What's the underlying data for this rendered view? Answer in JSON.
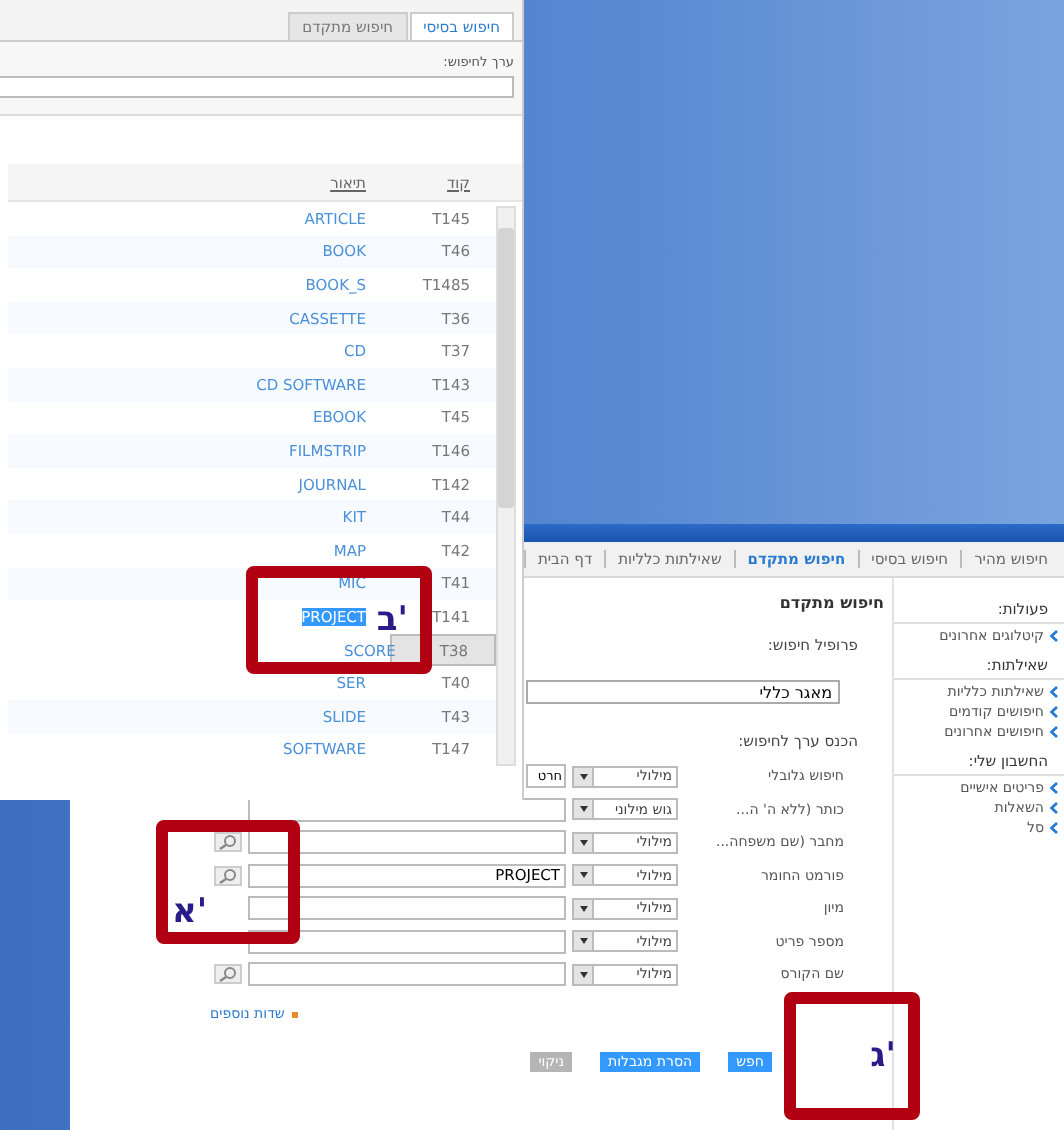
{
  "left_window": {
    "tabs": [
      {
        "label": "חיפוש בסיסי",
        "selected": true
      },
      {
        "label": "חיפוש מתקדם",
        "selected": false
      }
    ],
    "search_label": "ערך לחיפוש:",
    "table": {
      "columns": [
        "קוד",
        "תיאור"
      ],
      "rows": [
        {
          "code": "T145",
          "description": "ARTICLE",
          "selected": false,
          "text_selected": false
        },
        {
          "code": "T46",
          "description": "BOOK",
          "selected": false,
          "text_selected": false
        },
        {
          "code": "T1485",
          "description": "BOOK_S",
          "selected": false,
          "text_selected": false
        },
        {
          "code": "T36",
          "description": "CASSETTE",
          "selected": false,
          "text_selected": false
        },
        {
          "code": "T37",
          "description": "CD",
          "selected": false,
          "text_selected": false
        },
        {
          "code": "T143",
          "description": "CD SOFTWARE",
          "selected": false,
          "text_selected": false
        },
        {
          "code": "T45",
          "description": "EBOOK",
          "selected": false,
          "text_selected": false
        },
        {
          "code": "T146",
          "description": "FILMSTRIP",
          "selected": false,
          "text_selected": false
        },
        {
          "code": "T142",
          "description": "JOURNAL",
          "selected": false,
          "text_selected": false
        },
        {
          "code": "T44",
          "description": "KIT",
          "selected": false,
          "text_selected": false
        },
        {
          "code": "T42",
          "description": "MAP",
          "selected": false,
          "text_selected": false
        },
        {
          "code": "T41",
          "description": "MIC",
          "selected": false,
          "text_selected": false
        },
        {
          "code": "T141",
          "description": "PROJECT",
          "selected": false,
          "text_selected": true
        },
        {
          "code": "T38",
          "description": "SCORE",
          "selected": true,
          "text_selected": false
        },
        {
          "code": "T40",
          "description": "SER",
          "selected": false,
          "text_selected": false
        },
        {
          "code": "T43",
          "description": "SLIDE",
          "selected": false,
          "text_selected": false
        },
        {
          "code": "T147",
          "description": "SOFTWARE",
          "selected": false,
          "text_selected": false
        }
      ]
    }
  },
  "right_window": {
    "nav": [
      {
        "label": "חיפוש מהיר",
        "selected": false
      },
      {
        "label": "חיפוש בסיסי",
        "selected": false
      },
      {
        "label": "חיפוש מתקדם",
        "selected": true
      },
      {
        "label": "שאילתות כלליות",
        "selected": false
      },
      {
        "label": "דף הבית",
        "selected": false
      }
    ],
    "sidebar": [
      {
        "heading": "פעולות:",
        "items": [
          "קיטלוגים אחרונים"
        ]
      },
      {
        "heading": "שאילתות:",
        "items": [
          "שאילתות כלליות",
          "חיפושים קודמים",
          "חיפושים אחרונים"
        ]
      },
      {
        "heading": "החשבון שלי:",
        "items": [
          "פריטים אישיים",
          "השאלות",
          "סל"
        ]
      }
    ],
    "title": "חיפוש מתקדם",
    "profile_label": "פרופיל חיפוש:",
    "profile_value": "מאגר כללי",
    "enter_label": "הכנס ערך לחיפוש:",
    "fields": [
      {
        "label": "חיפוש גלובלי",
        "operator": "מילולי",
        "value": "חרט"
      },
      {
        "label": "כותר (ללא ה' ה...",
        "operator": "גוש מילוני",
        "lookup": false
      },
      {
        "label": "מחבר (שם משפחה...",
        "operator": "מילולי",
        "lookup": true
      },
      {
        "label": "פורמט החומר",
        "operator": "מילולי",
        "value": "PROJECT",
        "lookup": true
      },
      {
        "label": "מיון",
        "operator": "מילולי",
        "lookup": false
      },
      {
        "label": "מספר פריט",
        "operator": "מילולי",
        "lookup": false
      },
      {
        "label": "שם הקורס",
        "operator": "מילולי",
        "lookup": true
      }
    ],
    "more_fields": "שדות נוספים",
    "buttons": [
      {
        "label": "חפש",
        "kind": "highlighted"
      },
      {
        "label": "הסרת מגבלות",
        "kind": "highlighted"
      },
      {
        "label": "ניקוי",
        "kind": "plain"
      }
    ]
  },
  "annotations": [
    {
      "label": "ב'"
    },
    {
      "label": "א'"
    },
    {
      "label": "ג'"
    }
  ]
}
